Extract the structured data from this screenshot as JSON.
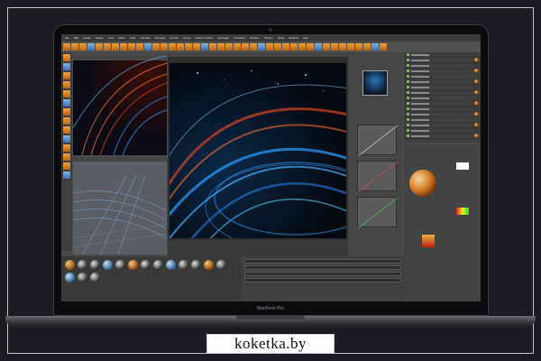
{
  "laptop": {
    "model_label": "MacBook Pro"
  },
  "app": {
    "menu": [
      "File",
      "Edit",
      "Create",
      "Select",
      "Tools",
      "Mesh",
      "Snap",
      "Animate",
      "Simulate",
      "Render",
      "Sculpt",
      "Motion Tracker",
      "MoGraph",
      "Character",
      "Pipeline",
      "Plugins",
      "Script",
      "Window",
      "Help"
    ]
  },
  "watermark": {
    "text": "koketka.by"
  },
  "colors": {
    "accent_orange": "#e8902c",
    "render_blue": "#2a8be0",
    "render_red": "#d2452a"
  }
}
